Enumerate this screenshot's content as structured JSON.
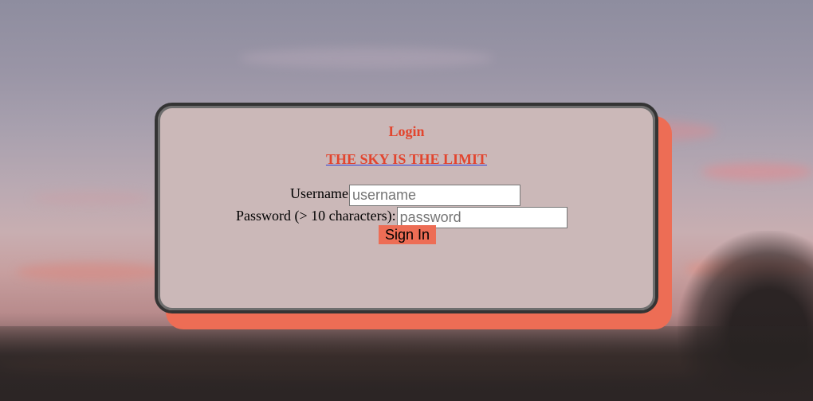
{
  "form": {
    "title": "Login",
    "link_text": "THE SKY IS THE LIMIT",
    "username_label": "Username",
    "username_placeholder": "username",
    "username_value": "",
    "password_label": "Password (> 10 characters):",
    "password_placeholder": "password",
    "password_value": "",
    "submit_label": "Sign In"
  },
  "colors": {
    "accent": "#ed6d55",
    "title_text": "#e2452e",
    "card_background": "#cbb8b8",
    "card_border": "#343434",
    "link_underline": "#2f3fd9"
  }
}
